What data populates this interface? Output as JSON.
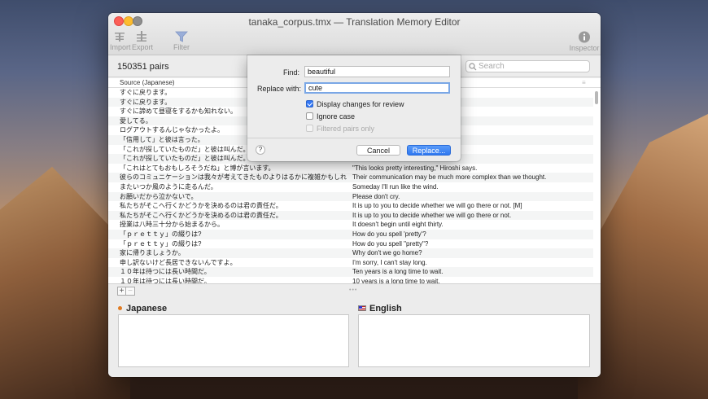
{
  "window": {
    "title": "tanaka_corpus.tmx — Translation Memory Editor"
  },
  "toolbar": {
    "import_label": "Import",
    "export_label": "Export",
    "filter_label": "Filter",
    "inspector_label": "Inspector",
    "icons": {
      "import": "import-icon",
      "export": "export-icon",
      "filter": "filter-funnel-icon",
      "inspector": "info-circle-icon"
    }
  },
  "subbar": {
    "pairs_count": "150351 pairs",
    "search_placeholder": "Search"
  },
  "table": {
    "source_header": "Source (Japanese)",
    "right_header": "≡",
    "rows": [
      {
        "source": "すぐに戻ります。",
        "target": ""
      },
      {
        "source": "すぐに戻ります。",
        "target": ""
      },
      {
        "source": "すぐに諦めて昼寝をするかも知れない。",
        "target": ""
      },
      {
        "source": "愛してる。",
        "target": ""
      },
      {
        "source": "ログアウトするんじゃなかったよ。",
        "target": ""
      },
      {
        "source": "「信用して」と彼は言った。",
        "target": ""
      },
      {
        "source": "「これが探していたものだ」と彼は叫んだ。",
        "target": "ned."
      },
      {
        "source": "「これが探していたものだ」と彼は叫んだ。",
        "target": "ned."
      },
      {
        "source": "「これはとてもおもしろそうだね」と博が言います。",
        "target": "\"This looks pretty interesting,\" Hiroshi says."
      },
      {
        "source": "彼らのコミュニケーションは我々が考えてきたものよりはるかに複雑かもしれません。",
        "target": "Their communication may be much more complex than we thought."
      },
      {
        "source": "またいつか風のように走るんだ。",
        "target": "Someday I'll run like the wind."
      },
      {
        "source": "お願いだから泣かないで。",
        "target": "Please don't cry."
      },
      {
        "source": "私たちがそこへ行くかどうかを決めるのは君の責任だ。",
        "target": "It is up to you to decide whether we will go there or not. [M]"
      },
      {
        "source": "私たちがそこへ行くかどうかを決めるのは君の責任だ。",
        "target": "It is up to you to decide whether we will go there or not."
      },
      {
        "source": "授業は八時三十分から始まるから。",
        "target": "It doesn't begin until eight thirty."
      },
      {
        "source": "「ｐｒｅｔｔｙ」の綴りは?",
        "target": "How do you spell 'pretty'?"
      },
      {
        "source": "「ｐｒｅｔｔｙ」の綴りは?",
        "target": "How do you spell \"pretty\"?"
      },
      {
        "source": "家に帰りましょうか。",
        "target": "Why don't we go home?"
      },
      {
        "source": "申し訳ないけど長居できないんですよ。",
        "target": "I'm sorry, I can't stay long."
      },
      {
        "source": "１０年は待つには長い時間だ。",
        "target": "Ten years is a long time to wait."
      },
      {
        "source": "１０年は待つには長い時間だ。",
        "target": "10 years is a long time to wait."
      }
    ]
  },
  "bottom": {
    "add_label": "+",
    "remove_label": "−",
    "grip": "•••",
    "japanese_label": "Japanese",
    "english_label": "English"
  },
  "dialog": {
    "find_label": "Find:",
    "find_value": "beautiful",
    "replace_label": "Replace with:",
    "replace_value": "cute",
    "display_changes_label": "Display changes for review",
    "display_changes_checked": true,
    "ignore_case_label": "Ignore case",
    "ignore_case_checked": false,
    "filtered_pairs_label": "Filtered pairs only",
    "filtered_pairs_checked": false,
    "help_label": "?",
    "cancel_label": "Cancel",
    "replace_button_label": "Replace..."
  },
  "colors": {
    "accent": "#3478f6",
    "language_dot": "#e07b22"
  }
}
